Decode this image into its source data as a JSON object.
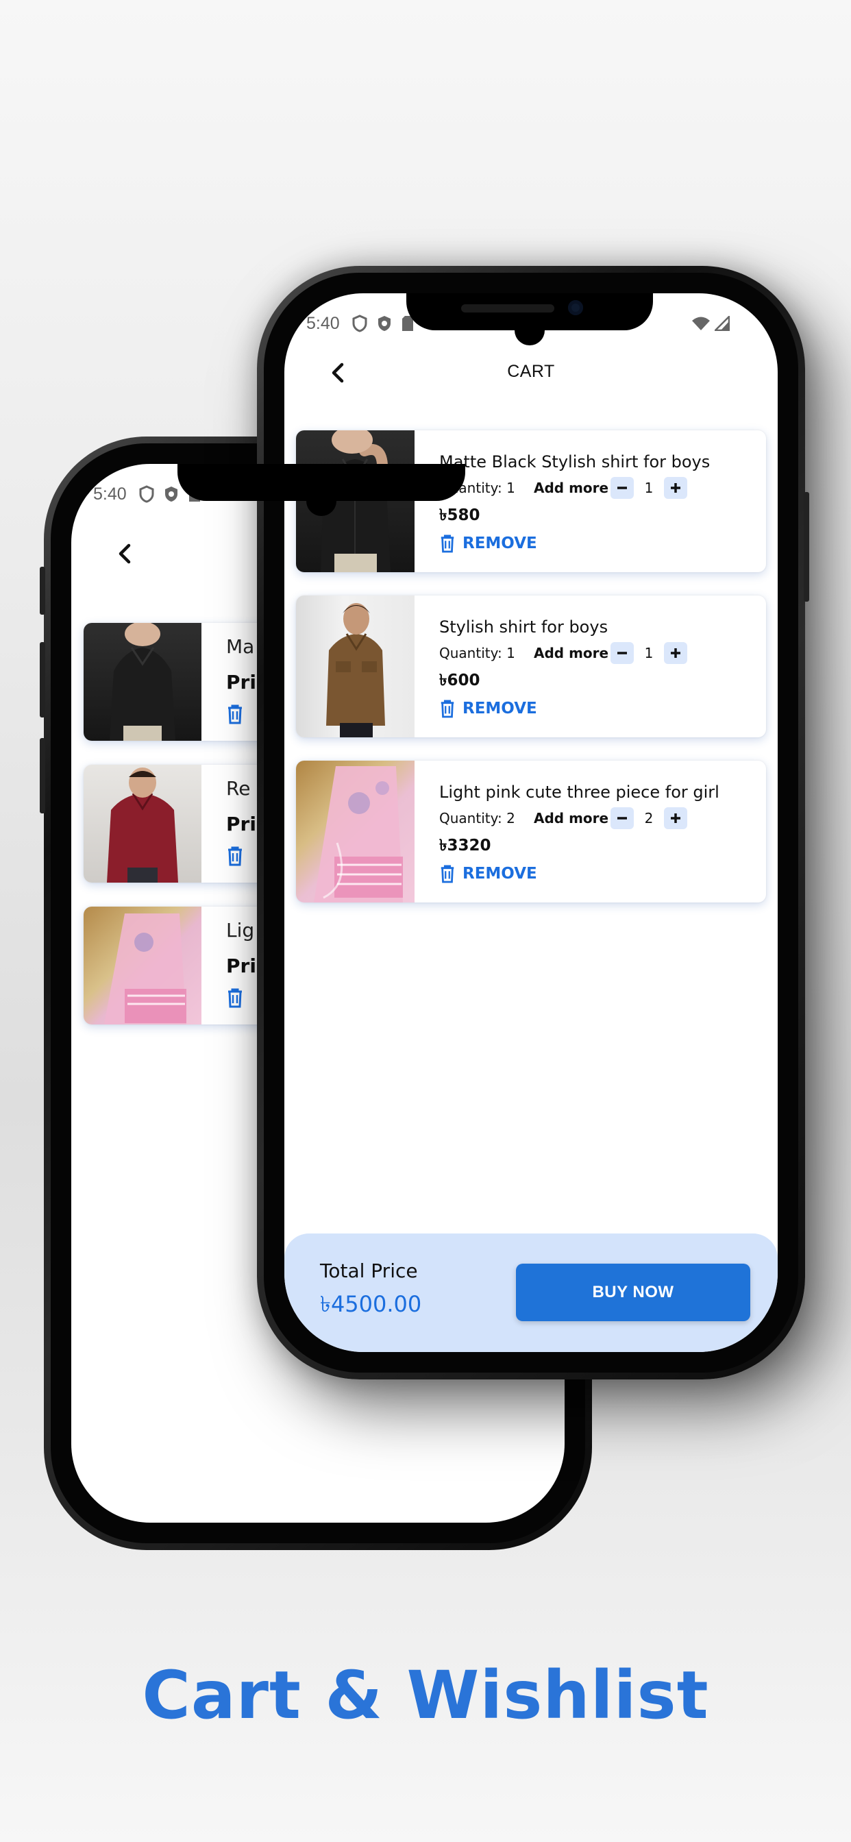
{
  "headline": "Cart & Wishlist",
  "colors": {
    "accent": "#1b6ede",
    "buy_button": "#1f73d8",
    "bottom_bar": "#d3e3fb",
    "qty_button": "#dbe7fb"
  },
  "status_bar": {
    "time": "5:40"
  },
  "header": {
    "title": "CART",
    "back_icon": "chevron-left-icon"
  },
  "cart": {
    "items": [
      {
        "title": "Matte Black Stylish shirt for boys",
        "quantity_label": "Quantity: 1",
        "add_more": "Add more",
        "quantity": "1",
        "price": "৳580",
        "remove": "REMOVE",
        "image": "black-shirt"
      },
      {
        "title": "Stylish shirt for boys",
        "quantity_label": "Quantity: 1",
        "add_more": "Add more",
        "quantity": "1",
        "price": "৳600",
        "remove": "REMOVE",
        "image": "brown-shirt"
      },
      {
        "title": "Light pink cute three piece for girl",
        "quantity_label": "Quantity: 2",
        "add_more": "Add more",
        "quantity": "2",
        "price": "৳3320",
        "remove": "REMOVE",
        "image": "pink-dress"
      }
    ]
  },
  "footer": {
    "total_label": "Total Price",
    "total_value": "৳4500.00",
    "buy_label": "BUY NOW"
  },
  "back_screen": {
    "time": "5:40",
    "items": [
      {
        "title": "Ma",
        "price": "Pri"
      },
      {
        "title": "Re",
        "price": "Pri"
      },
      {
        "title": "Lig",
        "price": "Pri"
      }
    ]
  }
}
